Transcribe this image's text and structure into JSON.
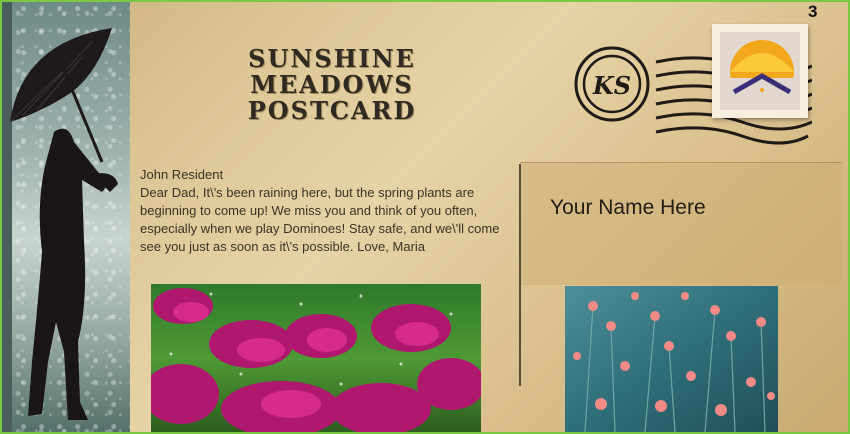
{
  "page_number": "3",
  "title_line1": "SUNSHINE MEADOWS",
  "title_line2": "POSTCARD",
  "postmark_initials": "KS",
  "recipient": "John Resident",
  "message": "Dear Dad, It\\'s been raining here, but the spring plants are beginning to come up! We miss you and think of you often, especially when we play Dominoes! Stay safe, and we\\'ll come see you just as soon as it\\'s possible. Love, Maria",
  "address_name": "Your Name Here",
  "colors": {
    "frame_border": "#7ac943",
    "paper": "#dcc593",
    "text": "#3b3327"
  },
  "icons": {
    "postmark": "postmark-icon",
    "stamp": "sun-stamp-icon"
  }
}
